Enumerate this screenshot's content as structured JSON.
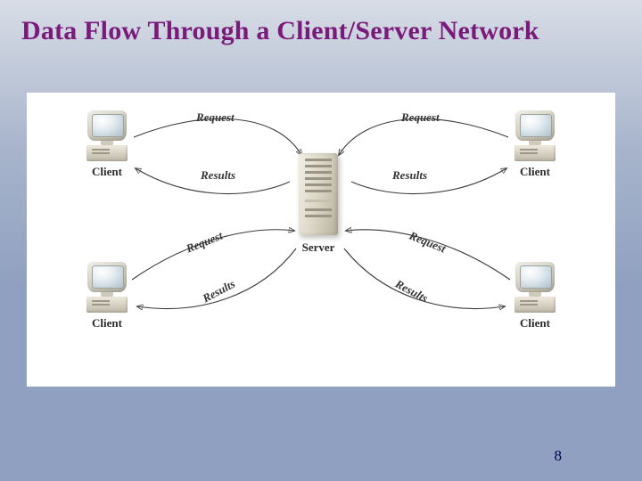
{
  "title": "Data Flow Through a Client/Server Network",
  "page_number": "8",
  "nodes": {
    "server": {
      "label": "Server"
    },
    "client_tl": {
      "label": "Client"
    },
    "client_tr": {
      "label": "Client"
    },
    "client_bl": {
      "label": "Client"
    },
    "client_br": {
      "label": "Client"
    }
  },
  "flows": {
    "tl_request": "Request",
    "tl_results": "Results",
    "tr_request": "Request",
    "tr_results": "Results",
    "bl_request": "Request",
    "bl_results": "Results",
    "br_request": "Request",
    "br_results": "Results"
  }
}
